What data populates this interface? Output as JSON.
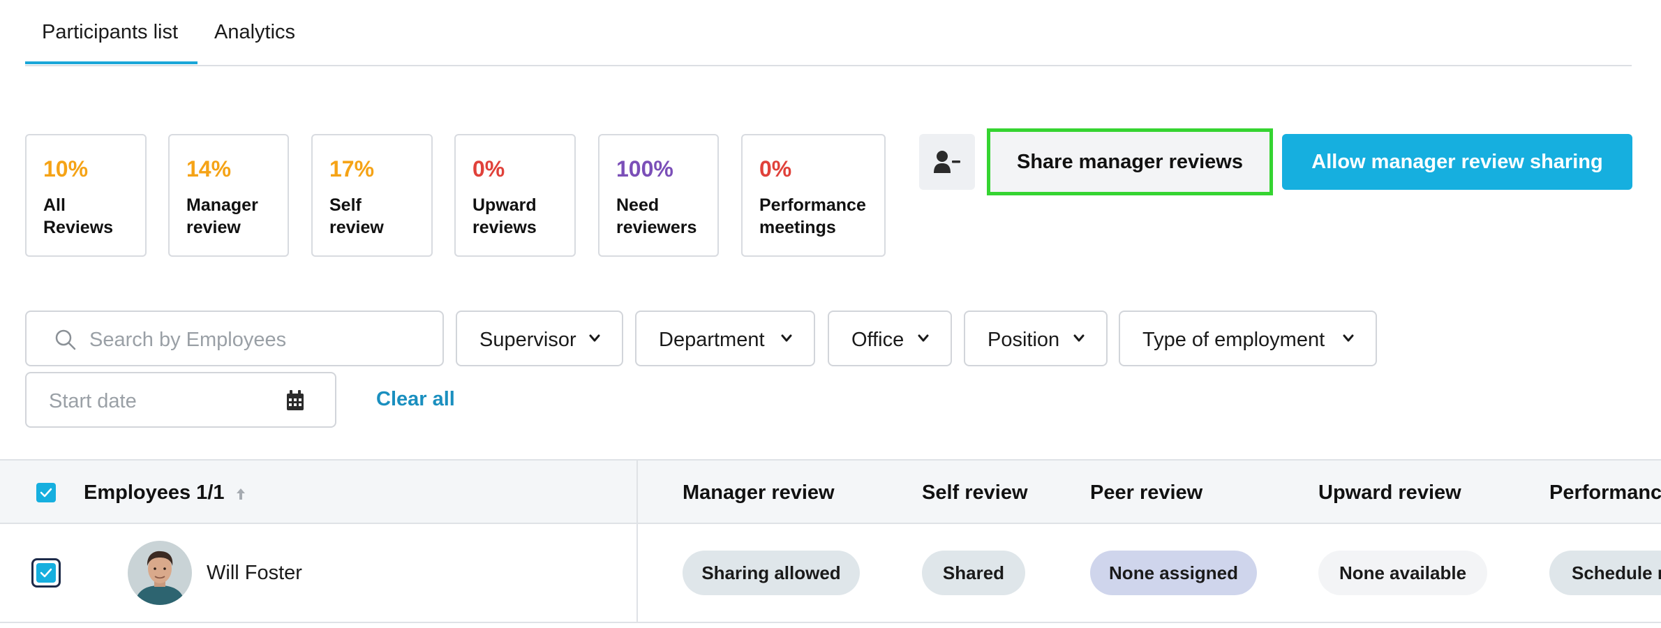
{
  "tabs": [
    {
      "label": "Participants list",
      "active": true
    },
    {
      "label": "Analytics",
      "active": false
    }
  ],
  "stats": [
    {
      "pct": "10%",
      "label_line1": "All",
      "label_line2": "Reviews",
      "color": "#f5a316"
    },
    {
      "pct": "14%",
      "label_line1": "Manager",
      "label_line2": "review",
      "color": "#f5a316"
    },
    {
      "pct": "17%",
      "label_line1": "Self",
      "label_line2": "review",
      "color": "#f5a316"
    },
    {
      "pct": "0%",
      "label_line1": "Upward",
      "label_line2": "reviews",
      "color": "#e0413a"
    },
    {
      "pct": "100%",
      "label_line1": "Need",
      "label_line2": "reviewers",
      "color": "#7b4fb8"
    },
    {
      "pct": "0%",
      "label_line1": "Performance",
      "label_line2": "meetings",
      "color": "#e0413a"
    }
  ],
  "actions": {
    "remove_participant_icon": "user-minus-icon",
    "share_label": "Share manager reviews",
    "allow_label": "Allow manager review sharing"
  },
  "filters": {
    "search_placeholder": "Search by Employees",
    "supervisor": "Supervisor",
    "department": "Department",
    "office": "Office",
    "position": "Position",
    "type_of_employment": "Type of employment",
    "start_date_placeholder": "Start date",
    "clear_all": "Clear all"
  },
  "table": {
    "headers": {
      "employees": "Employees 1/1",
      "manager_review": "Manager review",
      "self_review": "Self review",
      "peer_review": "Peer review",
      "upward_review": "Upward review",
      "performance": "Performance"
    },
    "rows": [
      {
        "name": "Will Foster",
        "checked": true,
        "manager_review": "Sharing allowed",
        "self_review": "Shared",
        "peer_review": "None assigned",
        "upward_review": "None available",
        "performance": "Schedule meeting"
      }
    ]
  },
  "colors": {
    "accent": "#16afdf",
    "highlight_border": "#35d431",
    "pill_gray": "#dfe6ea",
    "pill_lavender": "#cfd5ec",
    "pill_light": "#f3f4f6"
  }
}
